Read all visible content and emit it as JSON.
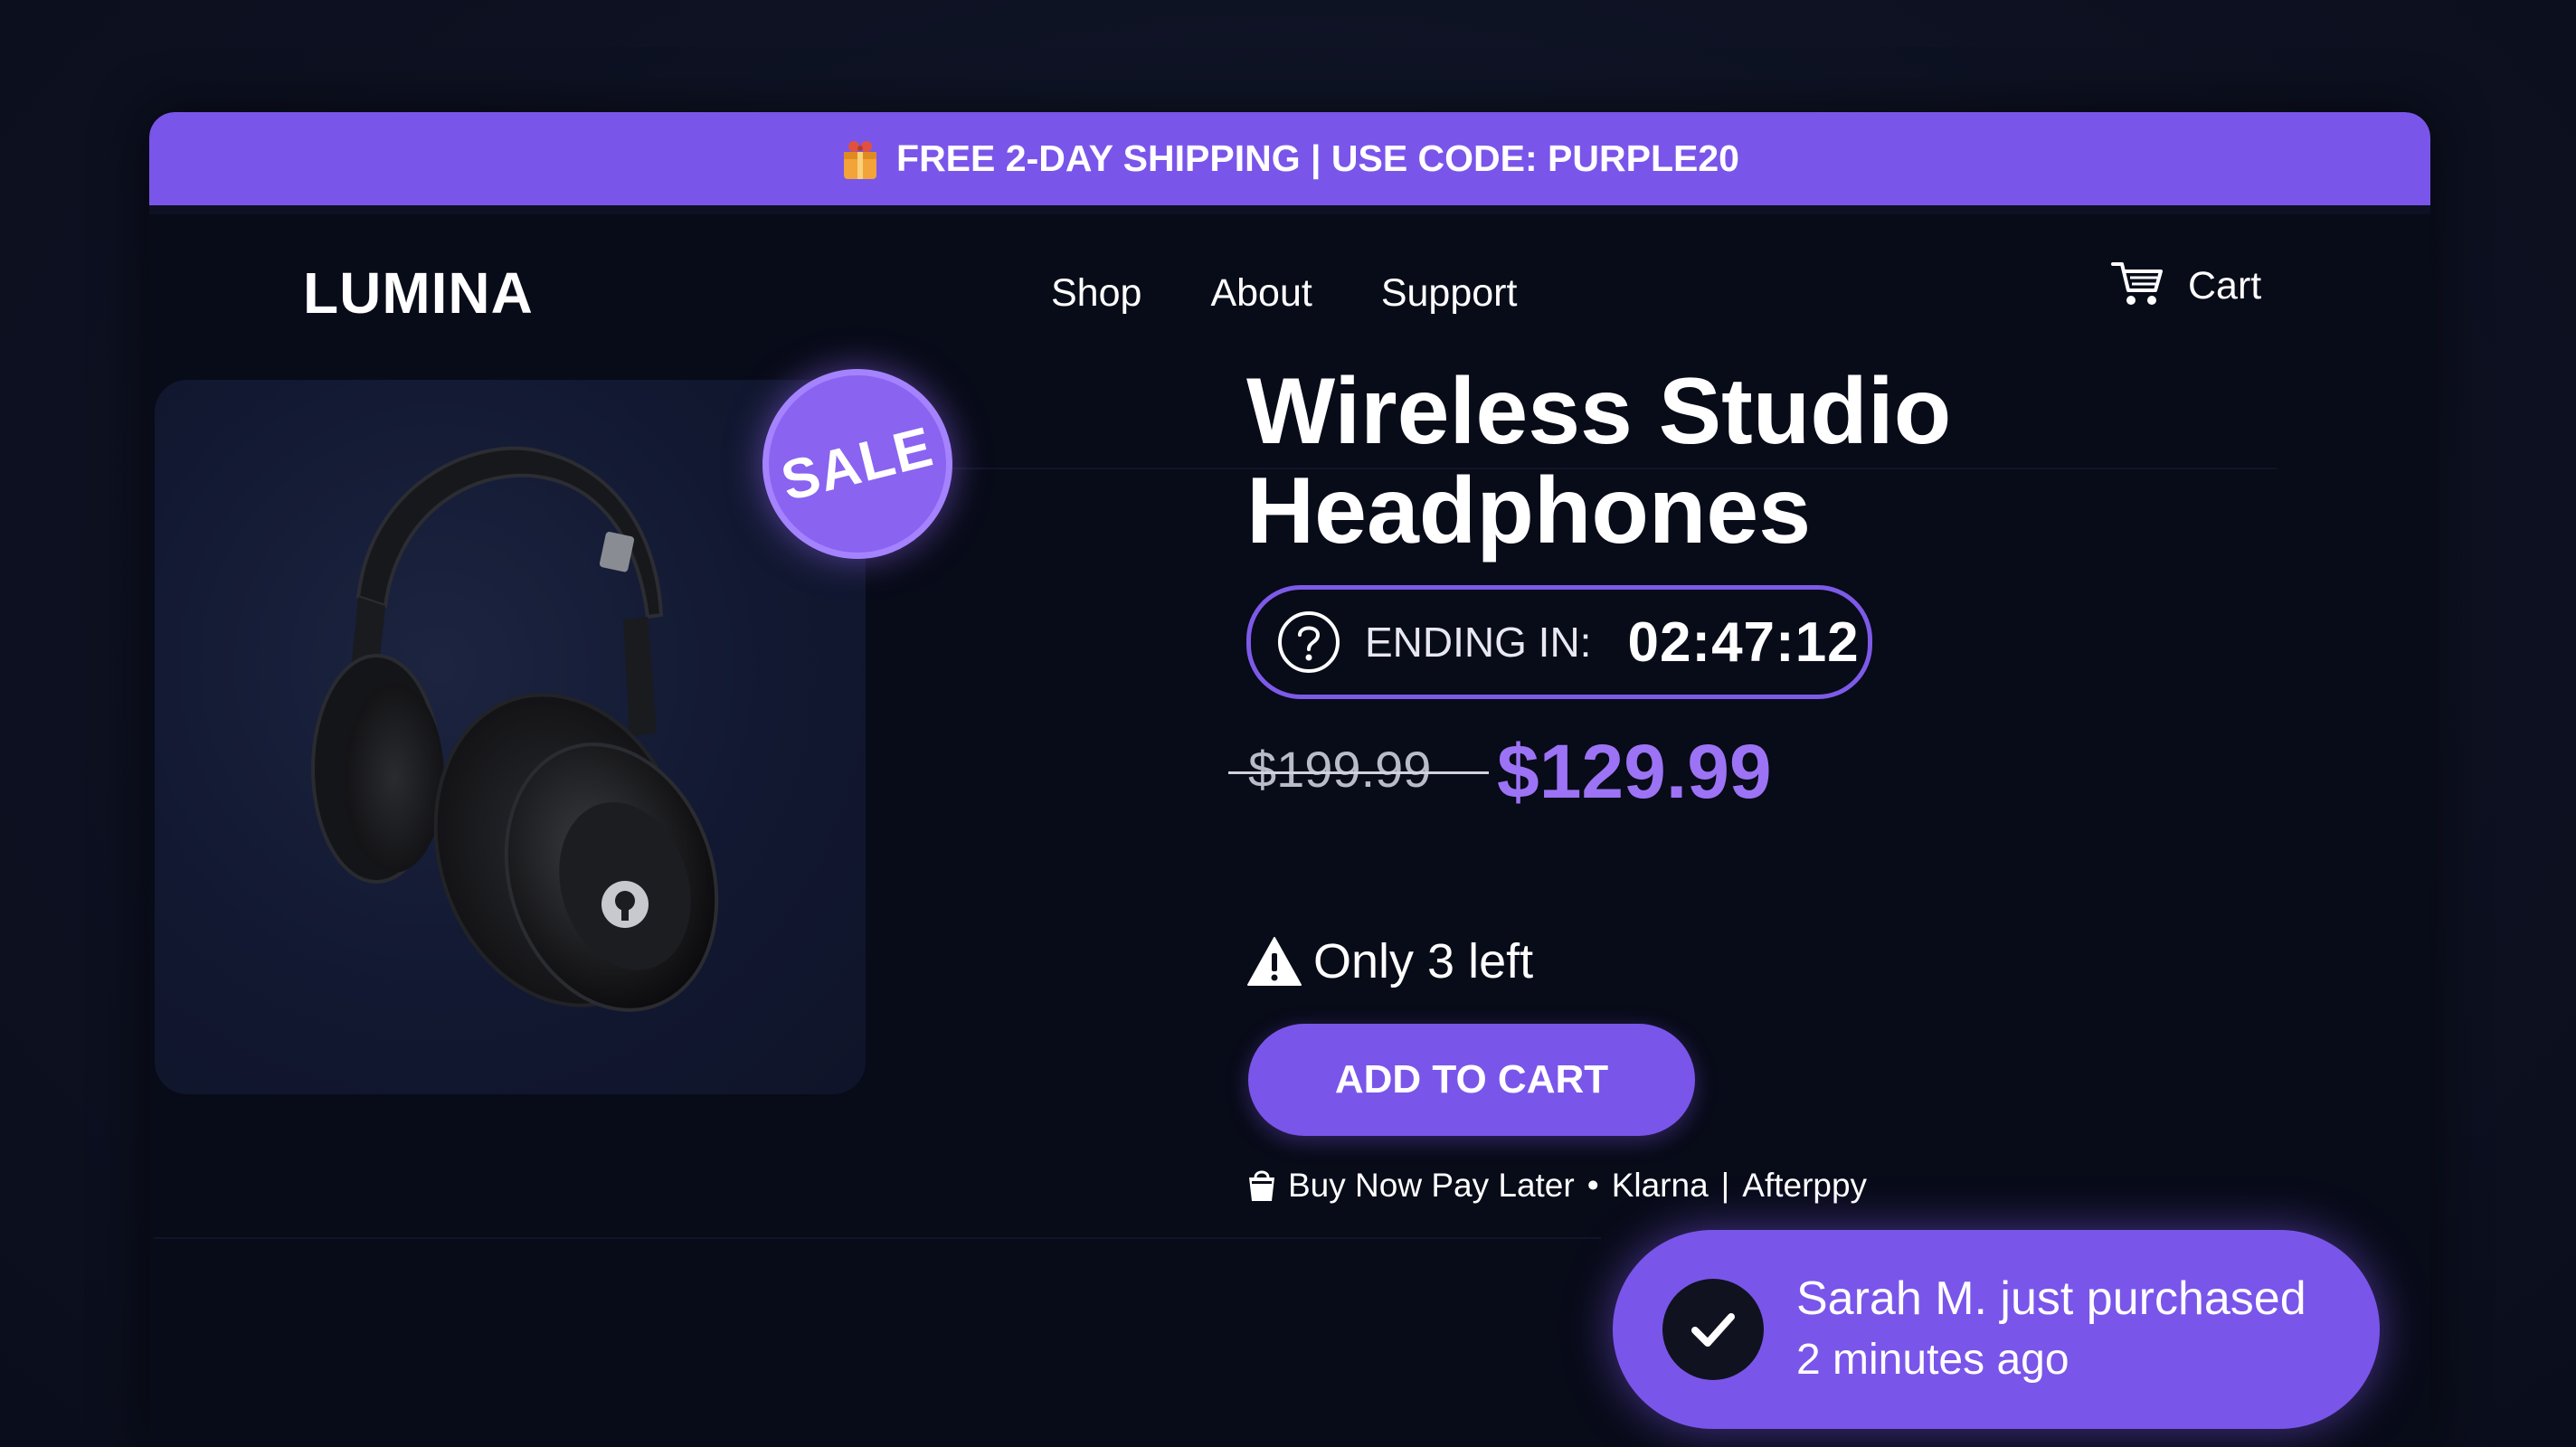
{
  "promo": {
    "icon": "gift-box-icon",
    "text": "FREE 2-DAY SHIPPING | USE CODE: PURPLE20"
  },
  "header": {
    "logo": "LUMINA",
    "nav": [
      {
        "label": "Shop"
      },
      {
        "label": "About"
      },
      {
        "label": "Support"
      }
    ],
    "cart": {
      "icon": "cart-icon",
      "label": "Cart"
    }
  },
  "product": {
    "image": "headphones-image",
    "badge": "SALE",
    "title_line1": "Wireless Studio",
    "title_line2": "Headphones",
    "timer": {
      "icon": "question-circle-icon",
      "label": "ENDING IN:",
      "value": "02:47:12"
    },
    "old_price": "$199.99",
    "new_price": "$129.99",
    "stock": {
      "icon": "warning-icon",
      "text": "Only 3 left"
    },
    "add_to_cart_label": "ADD TO CART",
    "bnpl": {
      "icon": "shopping-bag-icon",
      "text": "Buy Now Pay Later",
      "bullet": "•",
      "provider1": "Klarna",
      "separator": "|",
      "provider2": "Afterppy"
    }
  },
  "toast": {
    "icon": "check-icon",
    "line1": "Sarah M. just purchased",
    "line2": "2 minutes ago"
  },
  "colors": {
    "accent": "#7a55ea",
    "price_accent": "#9c73f5",
    "background": "#0d1121",
    "panel": "#080b18"
  }
}
